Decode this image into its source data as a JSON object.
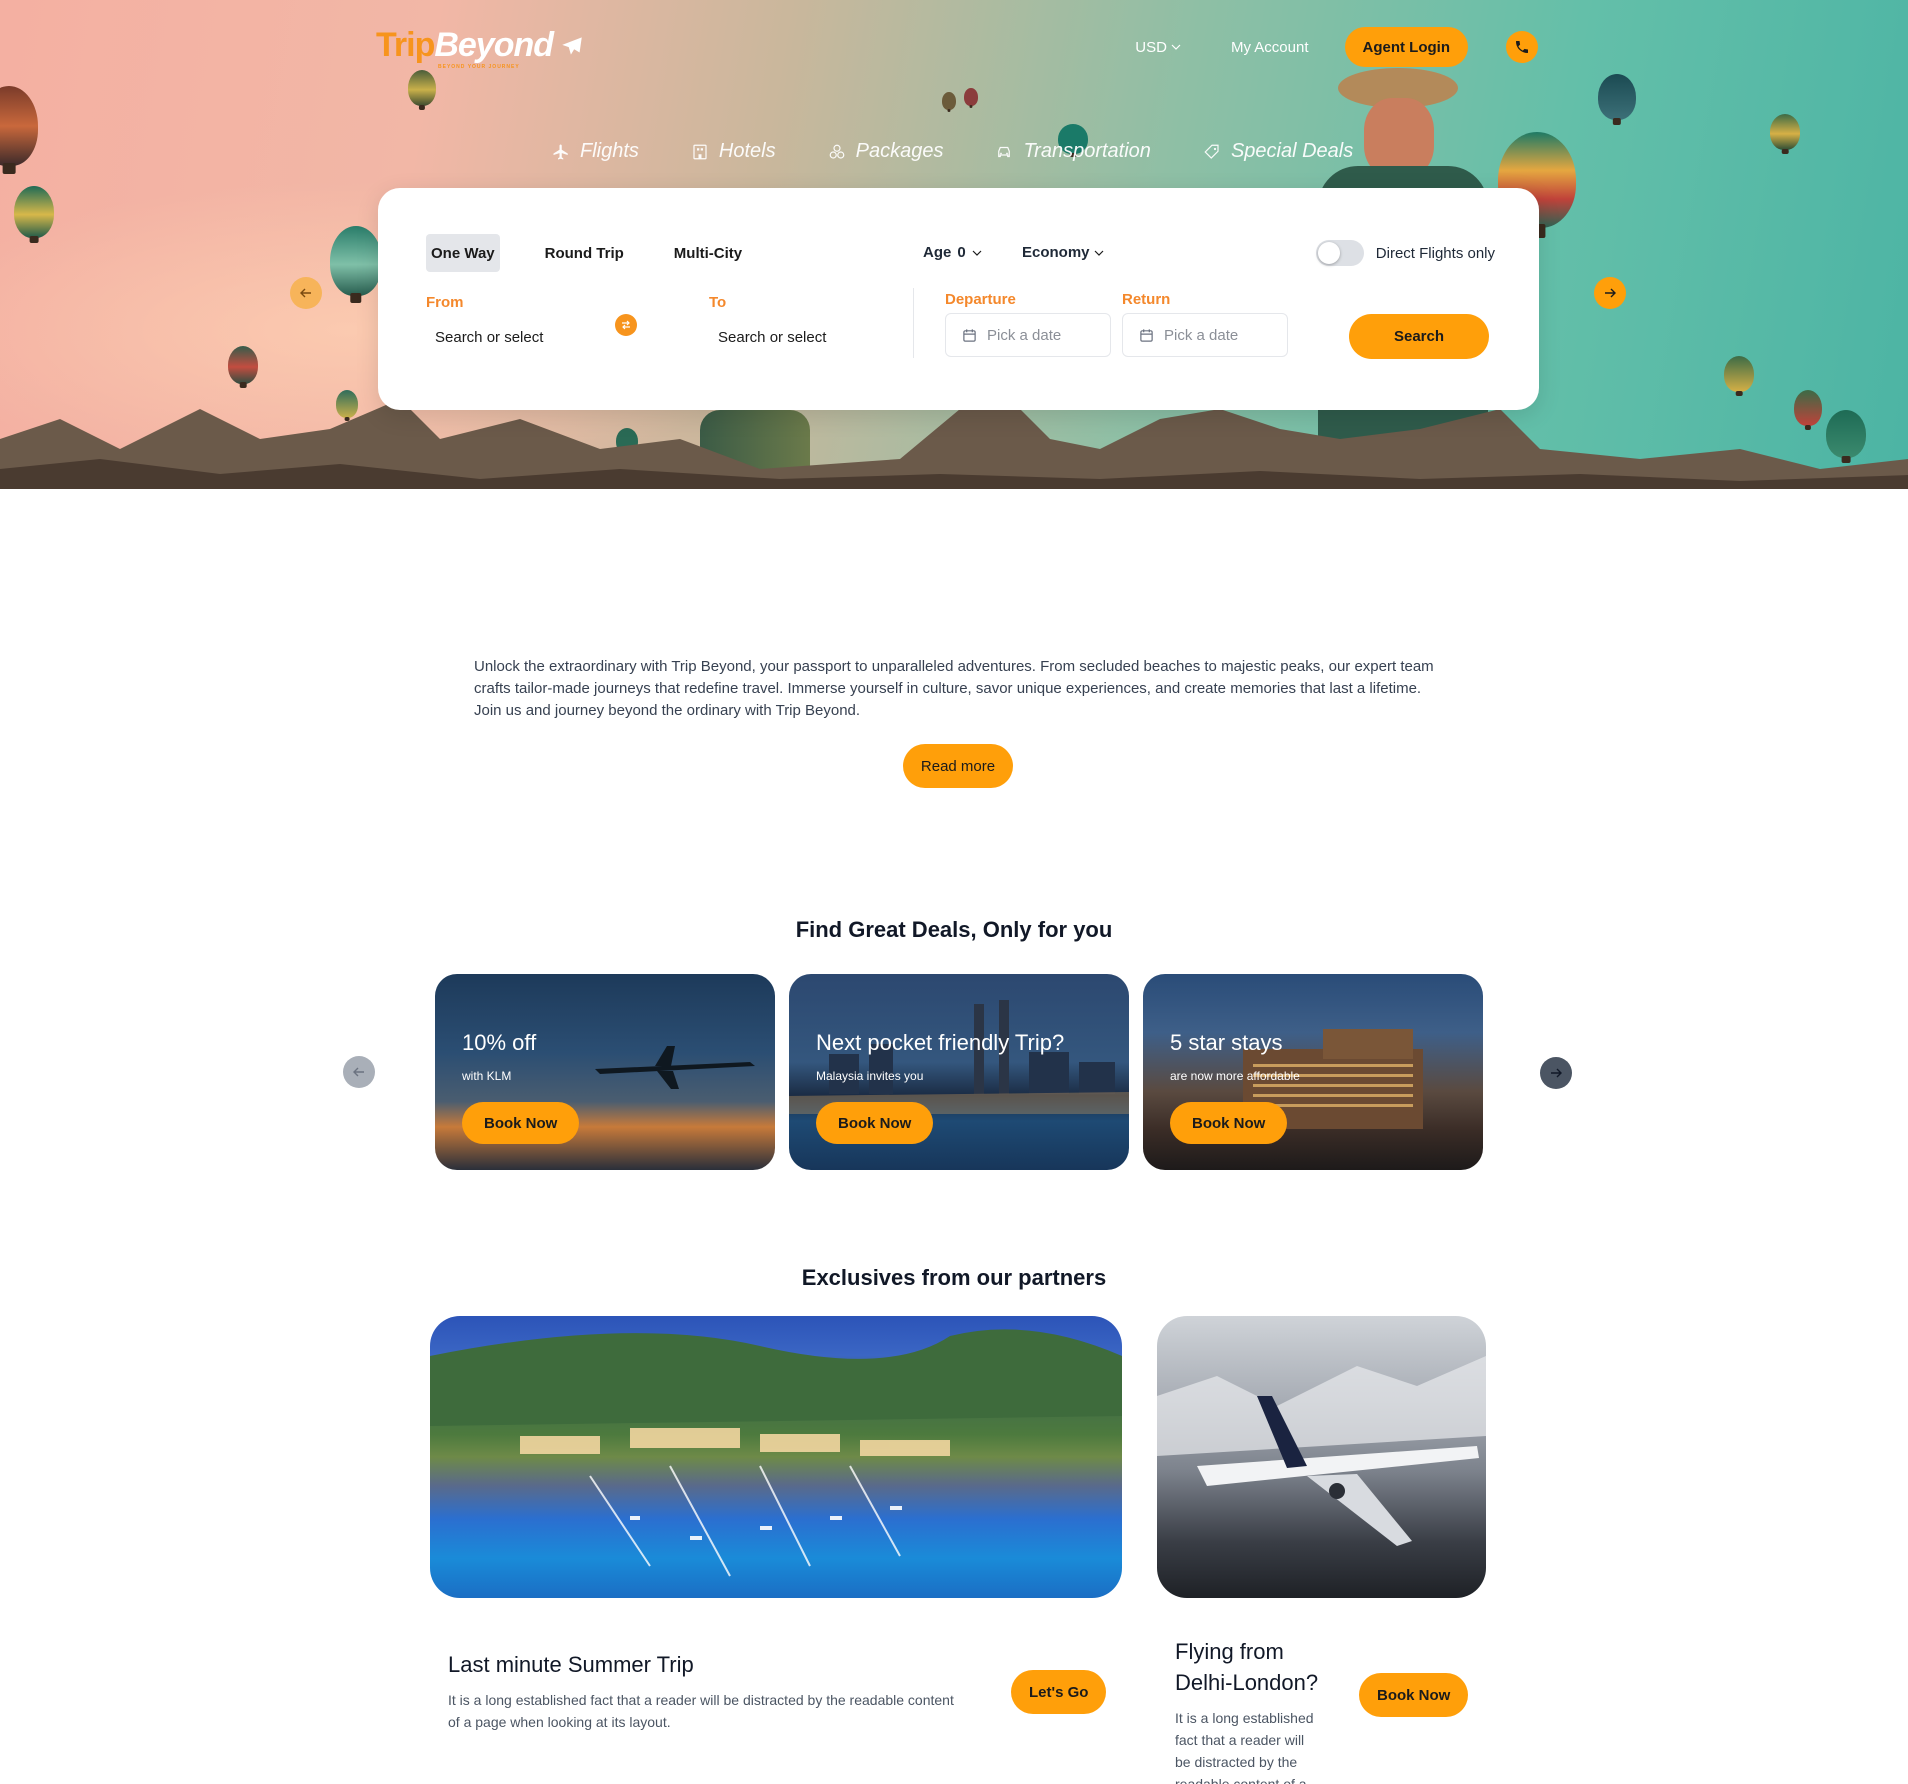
{
  "brand": {
    "name_part1": "Trip",
    "name_part2": "Beyond",
    "tagline": "BEYOND YOUR JOURNEY"
  },
  "topnav": {
    "currency": "USD",
    "account": "My Account",
    "agent_login": "Agent Login"
  },
  "tabs": [
    {
      "label": "Flights",
      "icon": "plane-icon"
    },
    {
      "label": "Hotels",
      "icon": "hotel-icon"
    },
    {
      "label": "Packages",
      "icon": "packages-icon"
    },
    {
      "label": "Transportation",
      "icon": "car-icon"
    },
    {
      "label": "Special Deals",
      "icon": "tag-icon"
    }
  ],
  "search": {
    "trip_types": [
      "One Way",
      "Round Trip",
      "Multi-City"
    ],
    "active_trip_type": "One Way",
    "age_label": "Age",
    "age_value": "0",
    "cabin": "Economy",
    "direct_label": "Direct Flights only",
    "direct_enabled": false,
    "from_label": "From",
    "from_value": "Search or select",
    "to_label": "To",
    "to_value": "Search or select",
    "departure_label": "Departure",
    "departure_placeholder": "Pick a date",
    "return_label": "Return",
    "return_placeholder": "Pick a date",
    "search_button": "Search"
  },
  "intro": {
    "text": "Unlock the extraordinary with Trip Beyond, your passport to unparalleled adventures. From secluded beaches to majestic peaks, our expert team crafts tailor-made journeys that redefine travel. Immerse yourself in culture, savor unique experiences, and create memories that last a lifetime. Join us and journey beyond the ordinary with Trip Beyond.",
    "read_more": "Read more"
  },
  "deals": {
    "title": "Find Great Deals, Only for you",
    "items": [
      {
        "title": "10% off",
        "subtitle": "with KLM",
        "button": "Book Now"
      },
      {
        "title": "Next pocket friendly Trip?",
        "subtitle": "Malaysia invites you",
        "button": "Book Now"
      },
      {
        "title": "5 star stays",
        "subtitle": "are now more affordable",
        "button": "Book Now"
      }
    ]
  },
  "partners": {
    "title": "Exclusives from our partners",
    "items": [
      {
        "title": "Last minute Summer Trip",
        "desc": "It is a long established fact that a reader will be distracted by the readable content of a page when looking at its layout.",
        "button": "Let's Go"
      },
      {
        "title_line1": "Flying from",
        "title_line2": "Delhi-London?",
        "desc_lines": [
          "It is a long established",
          "fact that a reader will",
          "be distracted by the",
          "readable content of a"
        ],
        "button": "Book Now"
      }
    ]
  },
  "colors": {
    "accent": "#ff9f0a",
    "label_orange": "#f4882c",
    "text_dark": "#111827"
  }
}
